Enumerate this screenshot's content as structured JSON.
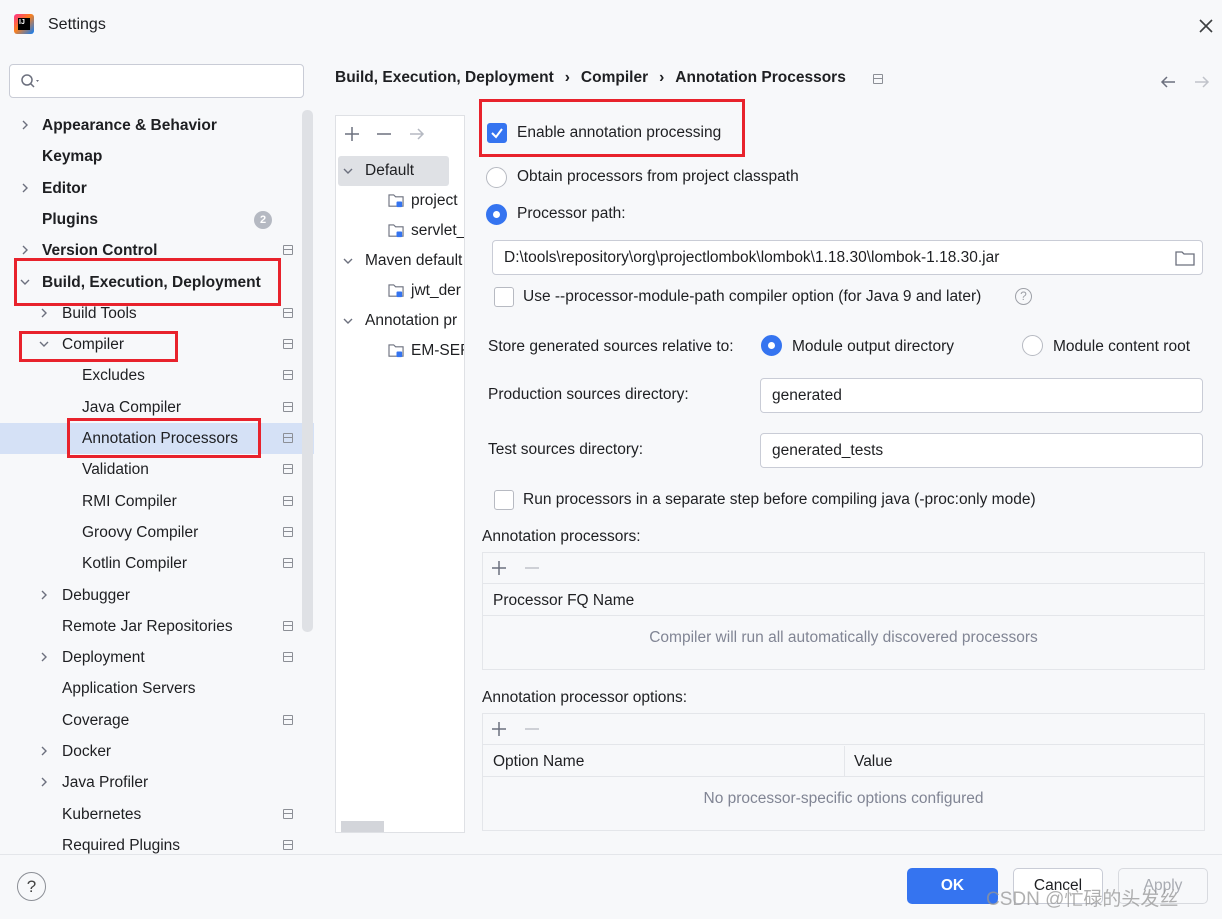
{
  "window": {
    "title": "Settings"
  },
  "search": {
    "placeholder": ""
  },
  "tree": {
    "items": [
      {
        "label": "Appearance & Behavior",
        "bold": true,
        "expandable": true,
        "expanded": false,
        "level": 0,
        "icon": false
      },
      {
        "label": "Keymap",
        "bold": true,
        "expandable": false,
        "level": 0,
        "icon": false
      },
      {
        "label": "Editor",
        "bold": true,
        "expandable": true,
        "expanded": false,
        "level": 0,
        "icon": false
      },
      {
        "label": "Plugins",
        "bold": true,
        "expandable": false,
        "level": 0,
        "icon": false,
        "badge": "2"
      },
      {
        "label": "Version Control",
        "bold": true,
        "expandable": true,
        "expanded": false,
        "level": 0,
        "icon": true
      },
      {
        "label": "Build, Execution, Deployment",
        "bold": true,
        "expandable": true,
        "expanded": true,
        "level": 0,
        "icon": false
      },
      {
        "label": "Build Tools",
        "bold": false,
        "expandable": true,
        "expanded": false,
        "level": 1,
        "icon": true
      },
      {
        "label": "Compiler",
        "bold": false,
        "expandable": true,
        "expanded": true,
        "level": 1,
        "icon": true
      },
      {
        "label": "Excludes",
        "bold": false,
        "expandable": false,
        "level": 2,
        "icon": true
      },
      {
        "label": "Java Compiler",
        "bold": false,
        "expandable": false,
        "level": 2,
        "icon": true
      },
      {
        "label": "Annotation Processors",
        "bold": false,
        "expandable": false,
        "level": 2,
        "icon": true,
        "selected": true
      },
      {
        "label": "Validation",
        "bold": false,
        "expandable": false,
        "level": 2,
        "icon": true
      },
      {
        "label": "RMI Compiler",
        "bold": false,
        "expandable": false,
        "level": 2,
        "icon": true
      },
      {
        "label": "Groovy Compiler",
        "bold": false,
        "expandable": false,
        "level": 2,
        "icon": true
      },
      {
        "label": "Kotlin Compiler",
        "bold": false,
        "expandable": false,
        "level": 2,
        "icon": true
      },
      {
        "label": "Debugger",
        "bold": false,
        "expandable": true,
        "expanded": false,
        "level": 1,
        "icon": false
      },
      {
        "label": "Remote Jar Repositories",
        "bold": false,
        "expandable": false,
        "level": 1,
        "icon": true
      },
      {
        "label": "Deployment",
        "bold": false,
        "expandable": true,
        "expanded": false,
        "level": 1,
        "icon": true
      },
      {
        "label": "Application Servers",
        "bold": false,
        "expandable": false,
        "level": 1,
        "icon": false
      },
      {
        "label": "Coverage",
        "bold": false,
        "expandable": false,
        "level": 1,
        "icon": true
      },
      {
        "label": "Docker",
        "bold": false,
        "expandable": true,
        "expanded": false,
        "level": 1,
        "icon": false
      },
      {
        "label": "Java Profiler",
        "bold": false,
        "expandable": true,
        "expanded": false,
        "level": 1,
        "icon": false
      },
      {
        "label": "Kubernetes",
        "bold": false,
        "expandable": false,
        "level": 1,
        "icon": true
      },
      {
        "label": "Required Plugins",
        "bold": false,
        "expandable": false,
        "level": 1,
        "icon": true
      }
    ]
  },
  "breadcrumb": {
    "items": [
      "Build, Execution, Deployment",
      "Compiler",
      "Annotation Processors"
    ],
    "separator": "›"
  },
  "profiles": {
    "rows": [
      {
        "label": "Default",
        "type": "group",
        "expanded": true,
        "selected": true
      },
      {
        "label": "project",
        "type": "module"
      },
      {
        "label": "servlet_",
        "type": "module"
      },
      {
        "label": "Maven default",
        "type": "group",
        "expanded": true
      },
      {
        "label": "jwt_der",
        "type": "module"
      },
      {
        "label": "Annotation pr",
        "type": "group",
        "expanded": true
      },
      {
        "label": "EM-SER",
        "type": "module"
      }
    ]
  },
  "settings": {
    "enable_annotation_processing": {
      "label": "Enable annotation processing",
      "checked": true
    },
    "obtain_from_classpath": {
      "label": "Obtain processors from project classpath",
      "selected": false
    },
    "processor_path": {
      "label": "Processor path:",
      "selected": true,
      "value": "D:\\tools\\repository\\org\\projectlombok\\lombok\\1.18.30\\lombok-1.18.30.jar"
    },
    "processor_module_path": {
      "label": "Use --processor-module-path compiler option (for Java 9 and later)",
      "checked": false
    },
    "store_generated": {
      "label": "Store generated sources relative to:",
      "options": [
        "Module output directory",
        "Module content root"
      ],
      "selected": "Module output directory"
    },
    "production_dir": {
      "label": "Production sources directory:",
      "value": "generated"
    },
    "test_dir": {
      "label": "Test sources directory:",
      "value": "generated_tests"
    },
    "separate_step": {
      "label": "Run processors in a separate step before compiling java (-proc:only mode)",
      "checked": false
    },
    "annotation_processors": {
      "title": "Annotation processors:",
      "columns": [
        "Processor FQ Name"
      ],
      "empty_text": "Compiler will run all automatically discovered processors"
    },
    "processor_options": {
      "title": "Annotation processor options:",
      "columns": [
        "Option Name",
        "Value"
      ],
      "empty_text": "No processor-specific options configured"
    }
  },
  "footer": {
    "help": "?",
    "ok": "OK",
    "cancel": "Cancel",
    "apply": "Apply"
  },
  "watermark": "CSDN @忙碌的头发丝",
  "colors": {
    "accent": "#3574f0",
    "highlight": "#e8222c",
    "selection": "#d5e1f6"
  }
}
